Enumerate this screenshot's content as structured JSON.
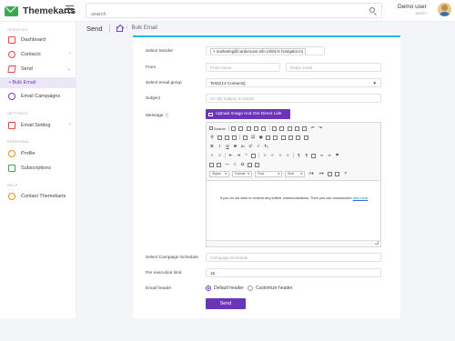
{
  "header": {
    "brand": "Themekarts",
    "search_placeholder": "search",
    "user_name": "Demo user",
    "user_role": "admin"
  },
  "sidebar": {
    "sections": {
      "services": "SERVICES",
      "settings": "SETTINGS",
      "personal": "PERSONAL",
      "help": "HELP"
    },
    "items": {
      "dashboard": "Dashboard",
      "contacts": "Contacts",
      "send": "Send",
      "bulk_email": "• Bulk Email",
      "email_campaigns": "Email Campaigns",
      "email_setting": "Email Setting",
      "profile": "Profile",
      "subscriptions": "Subscriptions",
      "contact_themekarts": "Contact Themekarts"
    }
  },
  "breadcrumb": {
    "title": "Send",
    "current": "Bulk Email"
  },
  "form": {
    "select_sender_label": "Select Sender",
    "sender_tag": "× marketing@cardencare.info (sh01% hostgator.in)",
    "from_label": "From",
    "from_name_placeholder": "From name",
    "reply_email_placeholder": "Reply email",
    "group_label": "Select email group",
    "group_value": "Test2(12 Contacts)",
    "subject_label": "Subject",
    "subject_placeholder": "ex: My subject is simple",
    "message_label": "Message ⓘ",
    "upload_button": "Upload Image And Get Direct Link",
    "toolbar_source": "Source",
    "toolbar_styles": "Styles",
    "toolbar_format": "Format",
    "toolbar_font": "Font",
    "toolbar_size": "Size",
    "message_body": "If you do not wish to recieve any further communications, Then you can unsubscribe",
    "message_link": "click here",
    "schedule_label": "Select Campaign Schedule",
    "schedule_placeholder": "Campaign Schedule",
    "limit_label": "Per execution limit",
    "limit_value": "15",
    "header_label": "Email header",
    "default_header": "Default header",
    "customize_header": "Customize header",
    "send_button": "Send"
  },
  "colors": {
    "accent": "#6c35b8",
    "card_top": "#2bb8e0",
    "brand": "#3aa852"
  }
}
